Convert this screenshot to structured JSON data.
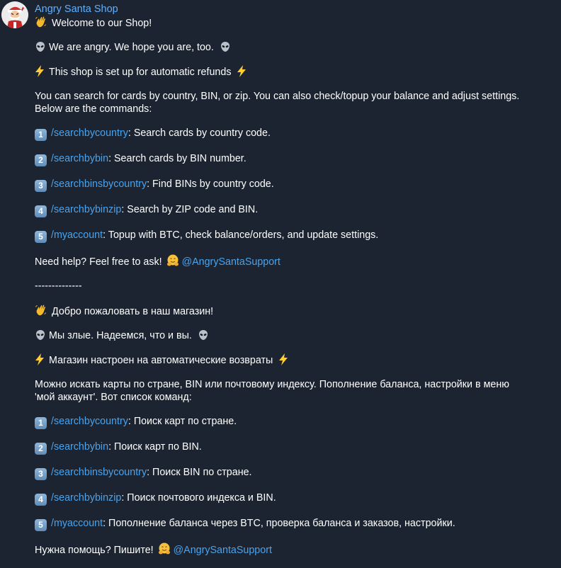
{
  "message": {
    "sender": "Angry Santa Shop",
    "en": {
      "welcome": "Welcome to our Shop!",
      "angry": "We are angry. We hope you are, too.",
      "refunds": "This shop is set up for automatic refunds",
      "intro": "You can search for cards by country, BIN, or zip. You can also check/topup your balance and adjust settings. Below are the commands:",
      "commands": [
        {
          "num": "1",
          "cmd": "/searchbycountry",
          "desc": ": Search cards by country code."
        },
        {
          "num": "2",
          "cmd": "/searchbybin",
          "desc": ": Search cards by BIN number."
        },
        {
          "num": "3",
          "cmd": "/searchbinsbycountry",
          "desc": ": Find BINs by country code."
        },
        {
          "num": "4",
          "cmd": "/searchbybinzip",
          "desc": ": Search by ZIP code and BIN."
        },
        {
          "num": "5",
          "cmd": "/myaccount",
          "desc": ": Topup with BTC, check balance/orders, and update settings."
        }
      ],
      "help_text": "Need help? Feel free to ask!",
      "support": "@AngrySantaSupport"
    },
    "divider": "--------------",
    "ru": {
      "welcome": "Добро пожаловать в наш магазин!",
      "angry": "Мы злые. Надеемся, что и вы.",
      "refunds": "Магазин настроен на автоматические возвраты",
      "intro": "Можно искать карты по стране, BIN или почтовому индексу. Пополнение баланса, настройки в меню 'мой аккаунт'. Вот список команд:",
      "commands": [
        {
          "num": "1",
          "cmd": "/searchbycountry",
          "desc": ": Поиск карт по стране."
        },
        {
          "num": "2",
          "cmd": "/searchbybin",
          "desc": ": Поиск карт по BIN."
        },
        {
          "num": "3",
          "cmd": "/searchbinsbycountry",
          "desc": ": Поиск BIN по стране."
        },
        {
          "num": "4",
          "cmd": "/searchbybinzip",
          "desc": ": Поиск почтового индекса и BIN."
        },
        {
          "num": "5",
          "cmd": "/myaccount",
          "desc": ": Пополнение баланса через BTC, проверка баланса и заказов, настройки."
        }
      ],
      "help_text": "Нужна помощь? Пишите!",
      "support": "@AngrySantaSupport"
    }
  },
  "colors": {
    "background": "#1b2430",
    "text": "#ffffff",
    "link": "#4aa3ee",
    "sender": "#5fb0ff"
  }
}
